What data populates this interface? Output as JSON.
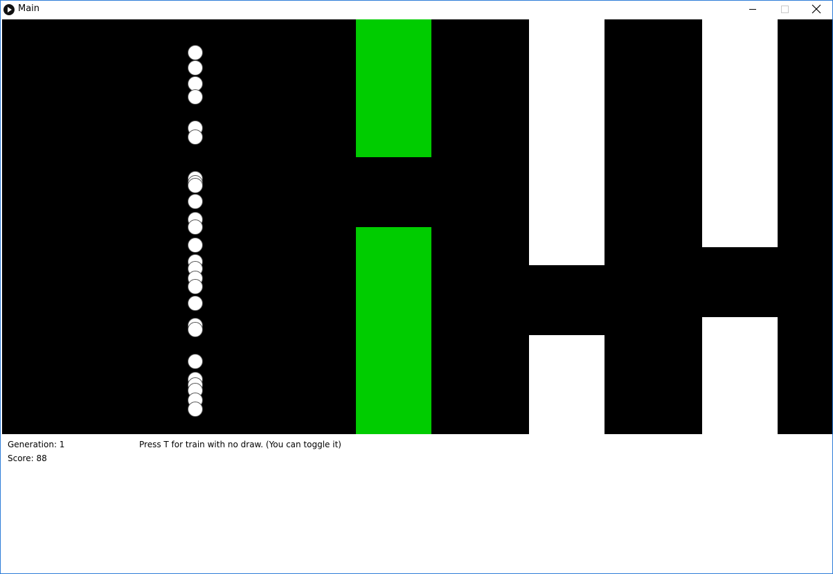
{
  "window": {
    "title": "Main"
  },
  "game": {
    "pipe_color_active": "#00cc00",
    "pipe_color": "#ffffff",
    "bird_color": "#ffffff",
    "background_color": "#000000",
    "bird_count": 33
  },
  "hud": {
    "generation_text": "Generation: 1",
    "score_text": "Score: 88",
    "hint_text": "Press T for train with no draw. (You can toggle it)"
  }
}
